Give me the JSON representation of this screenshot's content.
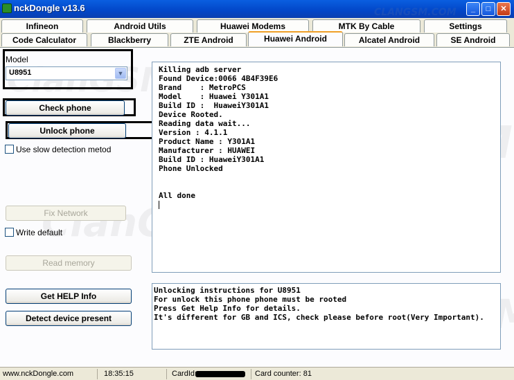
{
  "window": {
    "title": "nckDongle v13.6",
    "controls": {
      "minimize": "_",
      "maximize": "□",
      "close": "✕"
    }
  },
  "tabs_row1": [
    "Infineon",
    "Android Utils",
    "Huawei Modems",
    "MTK By Cable",
    "Settings"
  ],
  "tabs_row2": [
    "Code Calculator",
    "Blackberry",
    "ZTE Android",
    "Huawei Android",
    "Alcatel Android",
    "SE Android"
  ],
  "active_tab": "Huawei Android",
  "left_panel": {
    "model_label": "Model",
    "model_value": "U8951",
    "check_phone": "Check phone",
    "unlock_phone": "Unlock phone",
    "slow_detection": "Use slow detection metod",
    "fix_network": "Fix Network",
    "write_default": "Write default",
    "read_memory": "Read memory",
    "get_help_info": "Get HELP Info",
    "detect_device": "Detect device present"
  },
  "log": [
    "Killing adb server",
    "Found Device:0066 4B4F39E6",
    "Brand    : MetroPCS",
    "Model    : Huawei Y301A1",
    "Build ID :  HuaweiY301A1",
    "Device Rooted.",
    "Reading data wait...",
    "Version : 4.1.1",
    "Product Name : Y301A1",
    "Manufacturer : HUAWEI",
    "Build ID : HuaweiY301A1",
    "Phone Unlocked",
    "",
    "",
    "All done"
  ],
  "instructions": [
    "Unlocking instructions for U8951",
    "For unlock this phone phone must be rooted",
    "Press Get Help Info for details.",
    "It's different for GB and ICS, check please before root(Very Important)."
  ],
  "status": {
    "site": "www.nckDongle.com",
    "time": "18:35:15",
    "card_id_label": "CardId:",
    "card_counter": "Card counter: 81"
  },
  "watermark": {
    "big": "ClanGSM",
    "small": "CLANGSM.COM"
  }
}
